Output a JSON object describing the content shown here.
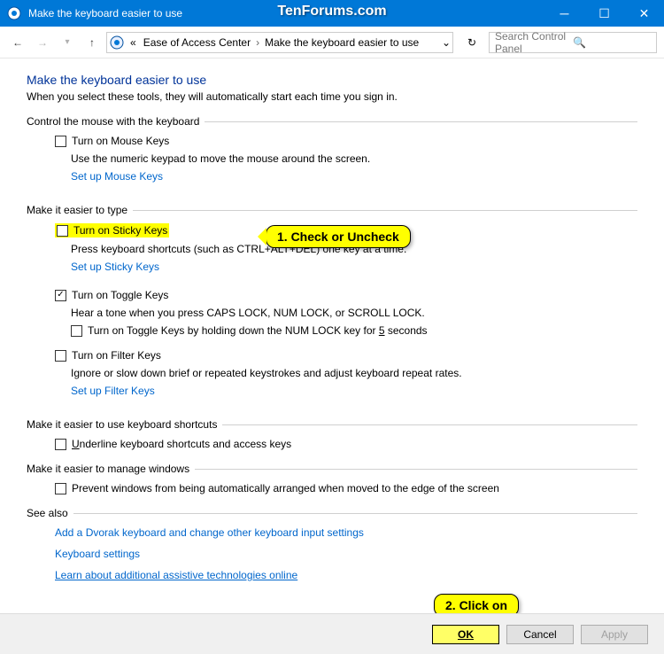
{
  "window": {
    "title": "Make the keyboard easier to use",
    "watermark": "TenForums.com"
  },
  "nav": {
    "back": "←",
    "forward": "→",
    "up": "↑",
    "crumb_prefix": "«",
    "crumb1": "Ease of Access Center",
    "crumb2": "Make the keyboard easier to use",
    "search_placeholder": "Search Control Panel"
  },
  "page": {
    "title": "Make the keyboard easier to use",
    "subtitle": "When you select these tools, they will automatically start each time you sign in."
  },
  "sections": {
    "mouse": {
      "header": "Control the mouse with the keyboard",
      "mouse_keys_label": "Turn on Mouse Keys",
      "mouse_keys_desc": "Use the numeric keypad to move the mouse around the screen.",
      "mouse_keys_link": "Set up Mouse Keys"
    },
    "type": {
      "header": "Make it easier to type",
      "sticky_label": "Turn on Sticky Keys",
      "sticky_desc": "Press keyboard shortcuts (such as CTRL+ALT+DEL) one key at a time.",
      "sticky_link": "Set up Sticky Keys",
      "toggle_label": "Turn on Toggle Keys",
      "toggle_desc": "Hear a tone when you press CAPS LOCK, NUM LOCK, or SCROLL LOCK.",
      "toggle_hold_pre": "Turn on Toggle Keys by holding down the NUM LOCK key for ",
      "toggle_hold_u": "5",
      "toggle_hold_post": " seconds",
      "filter_label": "Turn on Filter Keys",
      "filter_desc": "Ignore or slow down brief or repeated keystrokes and adjust keyboard repeat rates.",
      "filter_link": "Set up Filter Keys"
    },
    "shortcuts": {
      "header": "Make it easier to use keyboard shortcuts",
      "underline_u": "U",
      "underline_post": "nderline keyboard shortcuts and access keys"
    },
    "windows": {
      "header": "Make it easier to manage windows",
      "prevent_label": "Prevent windows from being automatically arranged when moved to the edge of the screen"
    },
    "seealso": {
      "header": "See also",
      "l1": "Add a Dvorak keyboard and change other keyboard input settings",
      "l2": "Keyboard settings",
      "l3": "Learn about additional assistive technologies online"
    }
  },
  "annotations": {
    "a1": "1. Check or Uncheck",
    "a2": "2. Click on"
  },
  "buttons": {
    "ok": "OK",
    "cancel": "Cancel",
    "apply": "Apply"
  }
}
